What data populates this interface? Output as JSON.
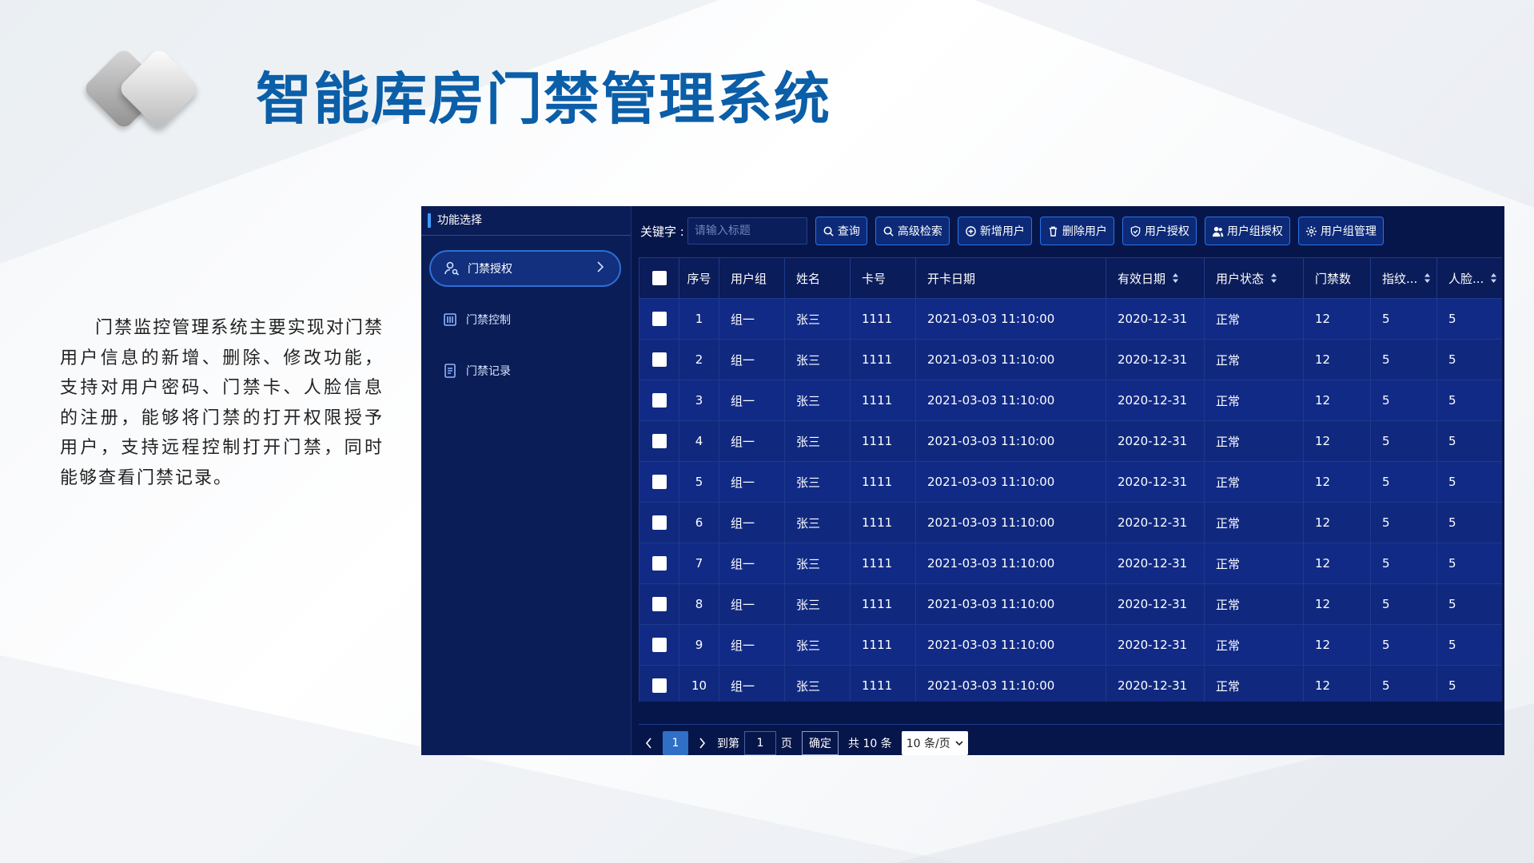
{
  "slide": {
    "title": "智能库房门禁管理系统",
    "description": "门禁监控管理系统主要实现对门禁用户信息的新增、删除、修改功能，支持对用户密码、门禁卡、人脸信息的注册，能够将门禁的打开权限授予用户，支持远程控制打开门禁，同时能够查看门禁记录。"
  },
  "sidebar": {
    "header": "功能选择",
    "items": [
      {
        "label": "门禁授权",
        "icon": "user-key-icon",
        "active": true
      },
      {
        "label": "门禁控制",
        "icon": "panel-icon",
        "active": false
      },
      {
        "label": "门禁记录",
        "icon": "record-icon",
        "active": false
      }
    ]
  },
  "toolbar": {
    "keyword_label": "关键字 :",
    "search_placeholder": "请输入标题",
    "buttons": [
      {
        "label": "查询",
        "icon": "search-icon"
      },
      {
        "label": "高级检索",
        "icon": "search-icon"
      },
      {
        "label": "新增用户",
        "icon": "plus-circle-icon"
      },
      {
        "label": "删除用户",
        "icon": "trash-icon"
      },
      {
        "label": "用户授权",
        "icon": "shield-check-icon"
      },
      {
        "label": "用户组授权",
        "icon": "users-icon"
      },
      {
        "label": "用户组管理",
        "icon": "gear-icon"
      }
    ]
  },
  "table": {
    "columns": [
      "",
      "序号",
      "用户组",
      "姓名",
      "卡号",
      "开卡日期",
      "有效日期",
      "用户状态",
      "门禁数",
      "指纹...",
      "人脸..."
    ],
    "sortable_columns": [
      6,
      7,
      9,
      10
    ],
    "rows": [
      [
        "1",
        "组一",
        "张三",
        "1111",
        "2021-03-03 11:10:00",
        "2020-12-31",
        "正常",
        "12",
        "5",
        "5"
      ],
      [
        "2",
        "组一",
        "张三",
        "1111",
        "2021-03-03 11:10:00",
        "2020-12-31",
        "正常",
        "12",
        "5",
        "5"
      ],
      [
        "3",
        "组一",
        "张三",
        "1111",
        "2021-03-03 11:10:00",
        "2020-12-31",
        "正常",
        "12",
        "5",
        "5"
      ],
      [
        "4",
        "组一",
        "张三",
        "1111",
        "2021-03-03 11:10:00",
        "2020-12-31",
        "正常",
        "12",
        "5",
        "5"
      ],
      [
        "5",
        "组一",
        "张三",
        "1111",
        "2021-03-03 11:10:00",
        "2020-12-31",
        "正常",
        "12",
        "5",
        "5"
      ],
      [
        "6",
        "组一",
        "张三",
        "1111",
        "2021-03-03 11:10:00",
        "2020-12-31",
        "正常",
        "12",
        "5",
        "5"
      ],
      [
        "7",
        "组一",
        "张三",
        "1111",
        "2021-03-03 11:10:00",
        "2020-12-31",
        "正常",
        "12",
        "5",
        "5"
      ],
      [
        "8",
        "组一",
        "张三",
        "1111",
        "2021-03-03 11:10:00",
        "2020-12-31",
        "正常",
        "12",
        "5",
        "5"
      ],
      [
        "9",
        "组一",
        "张三",
        "1111",
        "2021-03-03 11:10:00",
        "2020-12-31",
        "正常",
        "12",
        "5",
        "5"
      ],
      [
        "10",
        "组一",
        "张三",
        "1111",
        "2021-03-03 11:10:00",
        "2020-12-31",
        "正常",
        "12",
        "5",
        "5"
      ]
    ]
  },
  "pagination": {
    "current_page": "1",
    "goto_label": "到第",
    "goto_value": "1",
    "page_label": "页",
    "confirm_label": "确定",
    "total_label": "共 10 条",
    "page_size_label": "10 条/页"
  },
  "colors": {
    "title": "#0b5ea8",
    "app_bg": "#07164a",
    "row_bg": "#112a86",
    "button_border": "#2b73e6",
    "active_page": "#2f6fc6"
  }
}
